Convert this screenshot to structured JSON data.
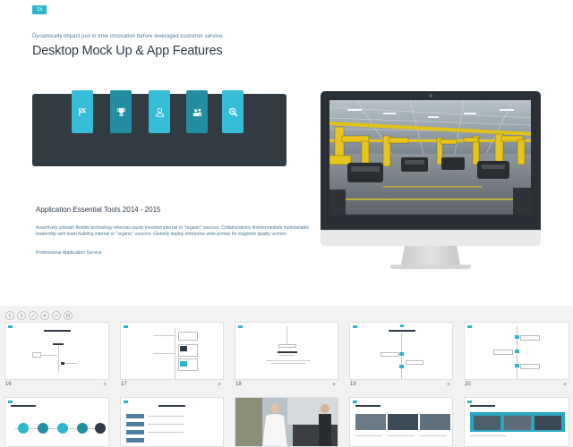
{
  "slide": {
    "number_badge": "15",
    "subtitle": "Dynamically impact just in time innovation before leveraged customer service.",
    "title": "Desktop Mock Up & App Features",
    "tabs": [
      {
        "icon": "flag-icon",
        "shade": "light"
      },
      {
        "icon": "trophy-icon",
        "shade": "dark"
      },
      {
        "icon": "user-icon",
        "shade": "light"
      },
      {
        "icon": "team-icon",
        "shade": "dark"
      },
      {
        "icon": "search-icon",
        "shade": "light"
      }
    ],
    "tools_title": "Application Essential Tools 2014 - 2015",
    "tools_body": "Assertively unleash flexible technology whereas equity invested internal or \"organic\" sources. Collaboratively disintermediate maintainable leadership with team building internal or \"organic\" sources. Globally deploy enterprise-wide portals for magnetic quality vectors.",
    "tools_footer": "Professional Application Service",
    "accent_color": "#35bcd6",
    "accent_dark": "#238da1",
    "panel_color": "#323a42"
  },
  "toolbar": {
    "buttons": [
      "back-icon",
      "forward-icon",
      "link-icon",
      "zoom-in-icon",
      "zoom-out-icon",
      "grid-icon"
    ]
  },
  "thumbnails": {
    "row1": [
      {
        "label": "16",
        "add": "+"
      },
      {
        "label": "17",
        "add": "+"
      },
      {
        "label": "18",
        "add": "+"
      },
      {
        "label": "19",
        "add": "+"
      },
      {
        "label": "20",
        "add": "+"
      }
    ]
  }
}
